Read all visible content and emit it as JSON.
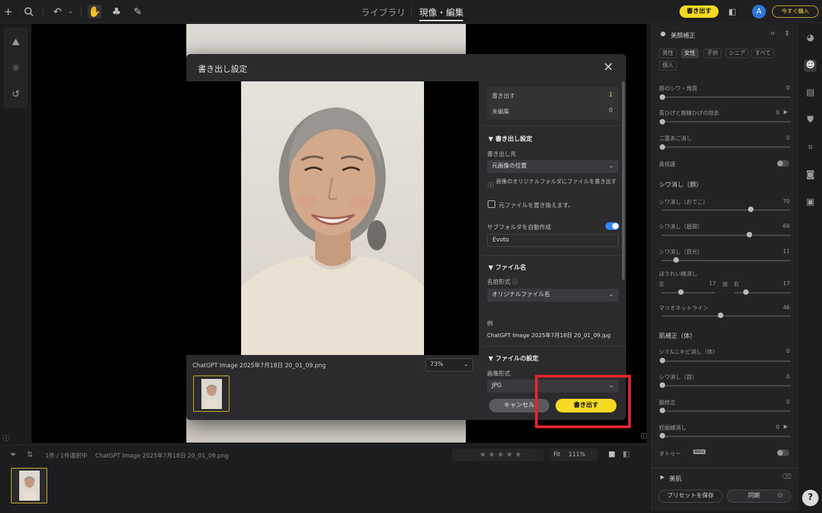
{
  "topbar": {
    "tabs": [
      "ライブラリ",
      "現像・編集"
    ],
    "active_tab": "現像・編集",
    "export_button": "書き出す",
    "avatar_letter": "A",
    "buy_button": "今すぐ購入"
  },
  "right_panel": {
    "title": "美顔補正",
    "chips": [
      "男性",
      "女性",
      "子供",
      "シニア",
      "すべて",
      "個人"
    ],
    "active_chip": "女性",
    "items": [
      {
        "label": "唇のシワ・角質",
        "value": "0"
      },
      {
        "label": "青ひげと無精ひげの除去",
        "value": "0"
      },
      {
        "label": "二重あご消し",
        "value": "0"
      },
      {
        "label": "鼻保護",
        "value": ""
      }
    ],
    "section_wrinkle": "シワ消し（顔）",
    "wrinkle_items": [
      {
        "label": "シワ消し（おでこ）",
        "value": "70"
      },
      {
        "label": "シワ消し（眉間）",
        "value": "69"
      },
      {
        "label": "シワ消し（目元）",
        "value": "11"
      }
    ],
    "nasolabial": {
      "label": "ほうれい線消し",
      "left_label": "左",
      "left_value": "17",
      "right_label": "右",
      "right_value": "17"
    },
    "marionette": {
      "label": "マリオネットライン",
      "value": "46"
    },
    "section_body": "肌補正（体）",
    "body_items": [
      {
        "label": "シミ&ニキビ消し（体）",
        "value": "0"
      },
      {
        "label": "シワ消し（首）",
        "value": "0"
      },
      {
        "label": "脇修正",
        "value": "0"
      },
      {
        "label": "妊娠線消し",
        "value": "0"
      },
      {
        "label": "タトゥー",
        "value": "",
        "badge": "Beta"
      }
    ],
    "beauty_skin": "美肌",
    "save_preset": "プリセットを保存",
    "sync": "同期"
  },
  "bottom_bar": {
    "selection": "1件 / 1件選択中",
    "filename": "ChatGPT Image 2025年7月18日 20_01_09.png",
    "fit": "Fit",
    "zoom": "111%"
  },
  "modal": {
    "title": "書き出し設定",
    "preview_filename": "ChatGPT Image 2025年7月18日 20_01_09.png",
    "preview_zoom": "73%",
    "summary": [
      {
        "label": "書き出す",
        "value": "1"
      },
      {
        "label": "未編集",
        "value": "0"
      }
    ],
    "export_settings_head": "書き出し設定",
    "destination_label": "書き出し先",
    "destination_value": "元画像の位置",
    "destination_info": "画像のオリジナルフォルダにファイルを書き出す",
    "overwrite_label": "元ファイルを置き換えます。",
    "subfolder_label": "サブフォルダを自動作成",
    "subfolder_value": "Evoto",
    "filename_head": "ファイル名",
    "name_format_label": "名前形式",
    "name_format_value": "オリジナルファイル名",
    "example_label": "例",
    "example_value": "ChatGPT Image 2025年7月18日 20_01_09.jpg",
    "file_settings_head": "ファイルの設定",
    "format_label": "画像形式",
    "format_value": "JPG",
    "cancel": "キャンセル",
    "export": "書き出す"
  },
  "colors": {
    "accent_yellow": "#f5d922",
    "highlight_red": "#e5242a",
    "toggle_blue": "#2f8bff"
  }
}
